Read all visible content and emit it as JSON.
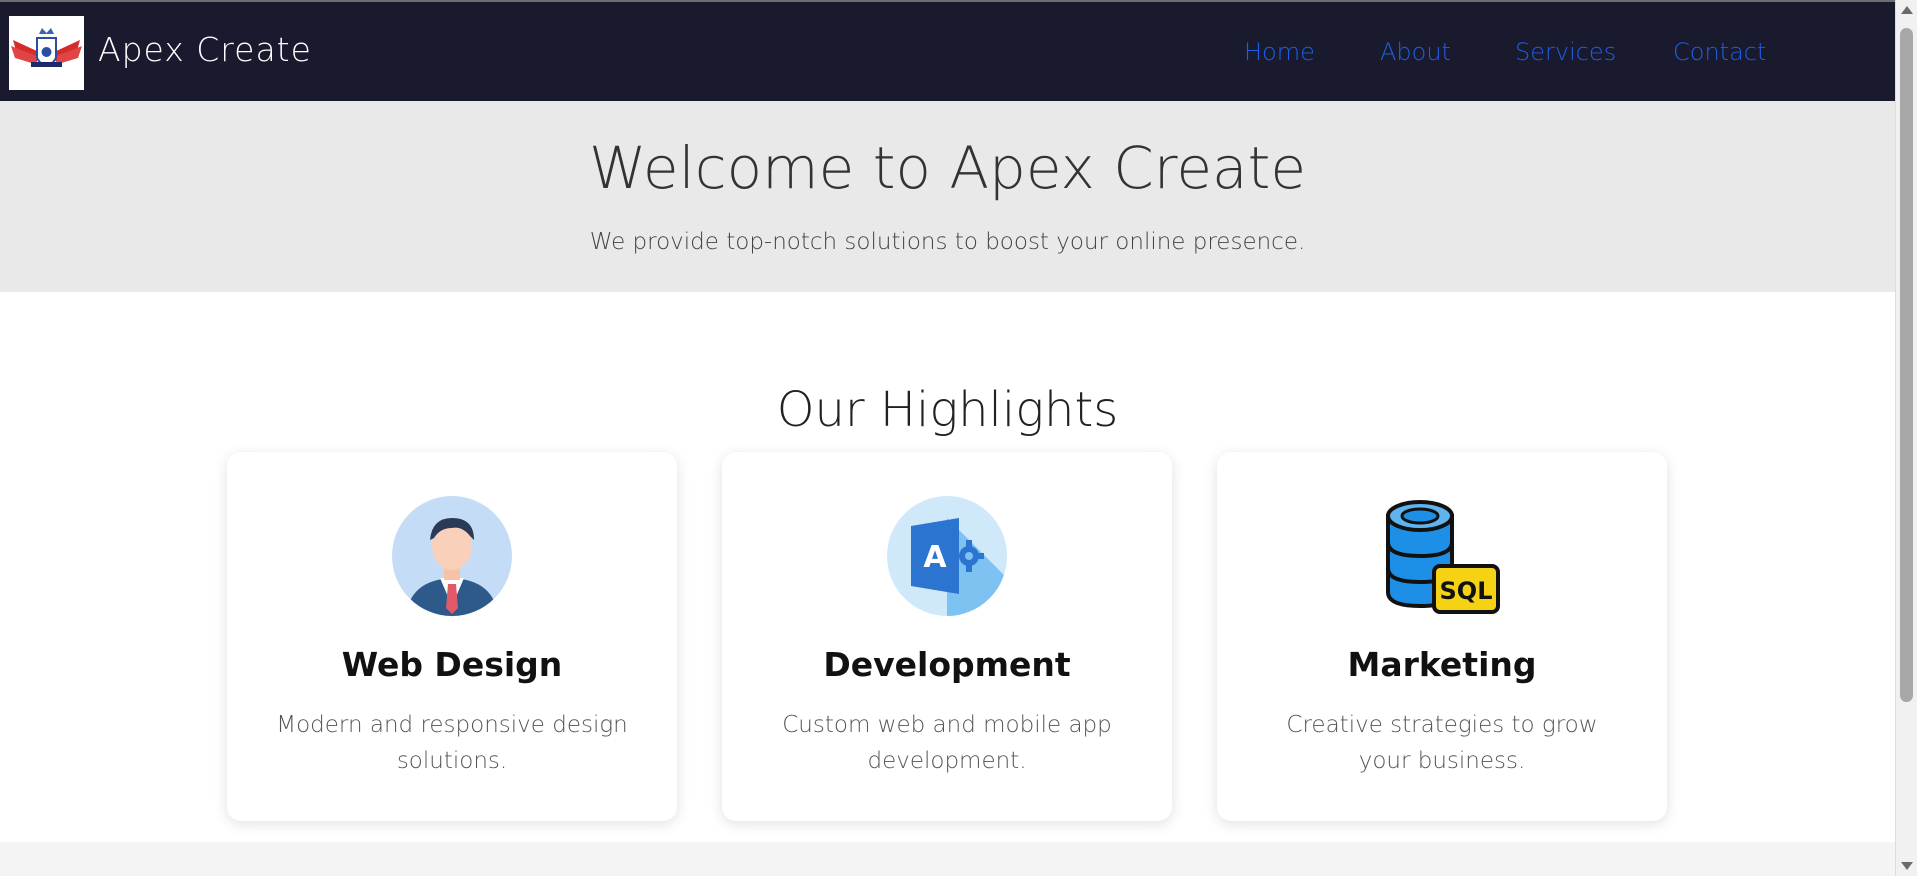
{
  "header": {
    "brand": "Apex Create",
    "logo_icon": "winged-shield-logo",
    "nav": [
      {
        "label": "Home"
      },
      {
        "label": "About"
      },
      {
        "label": "Services"
      },
      {
        "label": "Contact"
      }
    ]
  },
  "hero": {
    "title": "Welcome to Apex Create",
    "subtitle": "We provide top-notch solutions to boost your online presence."
  },
  "highlights": {
    "title": "Our Highlights",
    "cards": [
      {
        "icon": "businessman-avatar-icon",
        "title": "Web Design",
        "text": "Modern and responsive design solutions."
      },
      {
        "icon": "app-gear-icon",
        "title": "Development",
        "text": "Custom web and mobile app development."
      },
      {
        "icon": "sql-database-icon",
        "title": "Marketing",
        "text": "Creative strategies to grow your business."
      }
    ]
  },
  "colors": {
    "navbar_bg": "#1a1a2e",
    "nav_link": "#1e5ee6",
    "hero_bg": "#e9e9e9"
  }
}
